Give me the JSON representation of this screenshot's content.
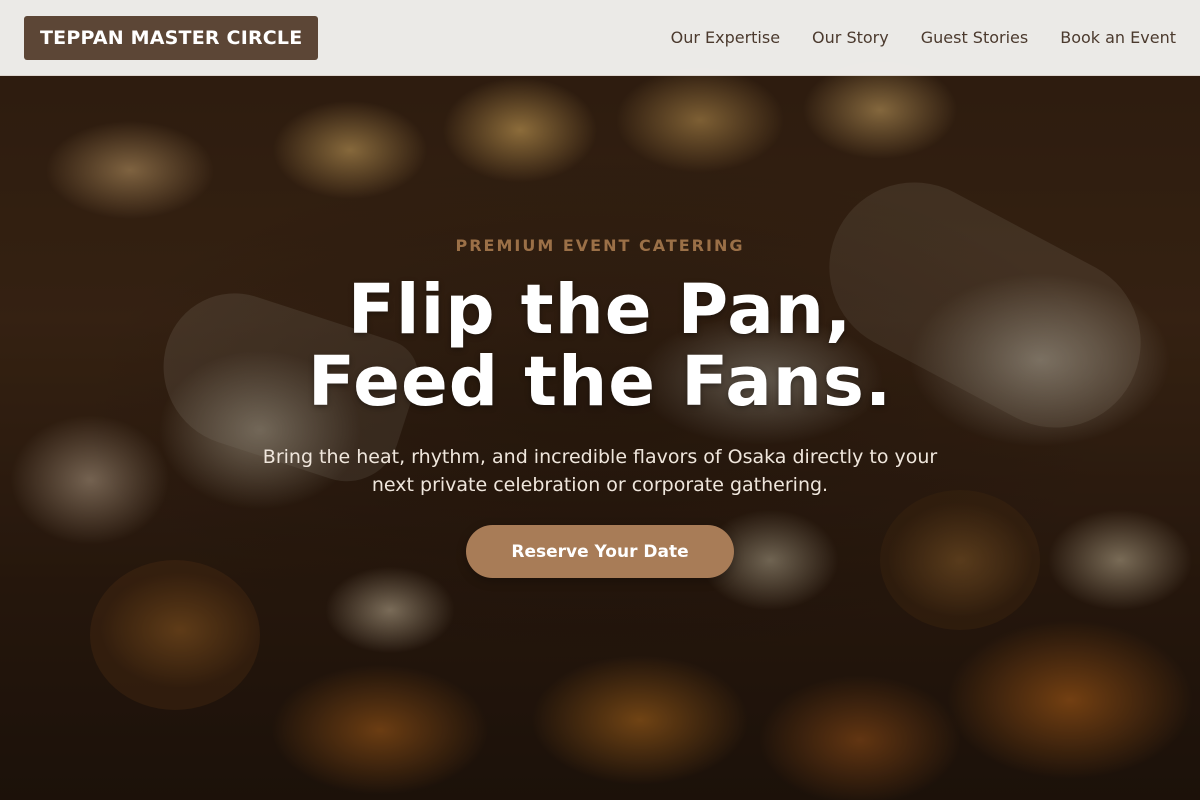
{
  "brand": {
    "name": "TEPPAN MASTER CIRCLE"
  },
  "nav": {
    "items": [
      {
        "label": "Our Expertise"
      },
      {
        "label": "Our Story"
      },
      {
        "label": "Guest Stories"
      },
      {
        "label": "Book an Event"
      }
    ]
  },
  "hero": {
    "eyebrow": "PREMIUM EVENT CATERING",
    "headline_line1": "Flip the Pan,",
    "headline_line2": "Feed the Fans.",
    "subtext": "Bring the heat, rhythm, and incredible flavors of Osaka directly to your next private celebration or corporate gathering.",
    "cta_label": "Reserve Your Date",
    "background_image": "food-platter-photo"
  },
  "colors": {
    "brand_bg": "#5c4636",
    "nav_text": "#4b3a2e",
    "eyebrow": "#9b7047",
    "cta_bg": "#a87c57"
  }
}
